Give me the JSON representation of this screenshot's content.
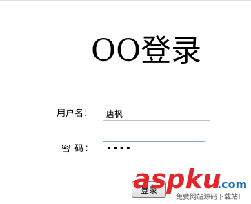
{
  "page": {
    "title": "OO登录"
  },
  "form": {
    "username_label": "用户名：",
    "username_value": "唐枫",
    "password_label": "密 码：",
    "password_value": "1234",
    "submit_label": "登录"
  },
  "watermark": {
    "brand": "aspku",
    "domain": ".com",
    "caption": "免费网站源码下载站!"
  },
  "colors": {
    "watermark_red": "#e3262b",
    "watermark_blue": "#1a6fb6",
    "input_focus_border": "#7fa7cc"
  }
}
